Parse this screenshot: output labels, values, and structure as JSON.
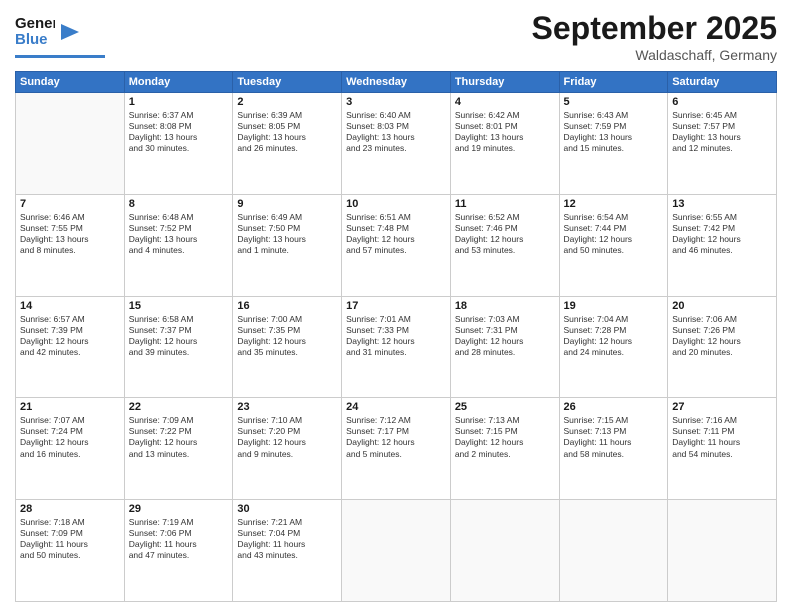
{
  "header": {
    "logo_line1": "General",
    "logo_line2": "Blue",
    "month": "September 2025",
    "location": "Waldaschaff, Germany"
  },
  "days_of_week": [
    "Sunday",
    "Monday",
    "Tuesday",
    "Wednesday",
    "Thursday",
    "Friday",
    "Saturday"
  ],
  "weeks": [
    [
      {
        "day": "",
        "info": ""
      },
      {
        "day": "1",
        "info": "Sunrise: 6:37 AM\nSunset: 8:08 PM\nDaylight: 13 hours\nand 30 minutes."
      },
      {
        "day": "2",
        "info": "Sunrise: 6:39 AM\nSunset: 8:05 PM\nDaylight: 13 hours\nand 26 minutes."
      },
      {
        "day": "3",
        "info": "Sunrise: 6:40 AM\nSunset: 8:03 PM\nDaylight: 13 hours\nand 23 minutes."
      },
      {
        "day": "4",
        "info": "Sunrise: 6:42 AM\nSunset: 8:01 PM\nDaylight: 13 hours\nand 19 minutes."
      },
      {
        "day": "5",
        "info": "Sunrise: 6:43 AM\nSunset: 7:59 PM\nDaylight: 13 hours\nand 15 minutes."
      },
      {
        "day": "6",
        "info": "Sunrise: 6:45 AM\nSunset: 7:57 PM\nDaylight: 13 hours\nand 12 minutes."
      }
    ],
    [
      {
        "day": "7",
        "info": "Sunrise: 6:46 AM\nSunset: 7:55 PM\nDaylight: 13 hours\nand 8 minutes."
      },
      {
        "day": "8",
        "info": "Sunrise: 6:48 AM\nSunset: 7:52 PM\nDaylight: 13 hours\nand 4 minutes."
      },
      {
        "day": "9",
        "info": "Sunrise: 6:49 AM\nSunset: 7:50 PM\nDaylight: 13 hours\nand 1 minute."
      },
      {
        "day": "10",
        "info": "Sunrise: 6:51 AM\nSunset: 7:48 PM\nDaylight: 12 hours\nand 57 minutes."
      },
      {
        "day": "11",
        "info": "Sunrise: 6:52 AM\nSunset: 7:46 PM\nDaylight: 12 hours\nand 53 minutes."
      },
      {
        "day": "12",
        "info": "Sunrise: 6:54 AM\nSunset: 7:44 PM\nDaylight: 12 hours\nand 50 minutes."
      },
      {
        "day": "13",
        "info": "Sunrise: 6:55 AM\nSunset: 7:42 PM\nDaylight: 12 hours\nand 46 minutes."
      }
    ],
    [
      {
        "day": "14",
        "info": "Sunrise: 6:57 AM\nSunset: 7:39 PM\nDaylight: 12 hours\nand 42 minutes."
      },
      {
        "day": "15",
        "info": "Sunrise: 6:58 AM\nSunset: 7:37 PM\nDaylight: 12 hours\nand 39 minutes."
      },
      {
        "day": "16",
        "info": "Sunrise: 7:00 AM\nSunset: 7:35 PM\nDaylight: 12 hours\nand 35 minutes."
      },
      {
        "day": "17",
        "info": "Sunrise: 7:01 AM\nSunset: 7:33 PM\nDaylight: 12 hours\nand 31 minutes."
      },
      {
        "day": "18",
        "info": "Sunrise: 7:03 AM\nSunset: 7:31 PM\nDaylight: 12 hours\nand 28 minutes."
      },
      {
        "day": "19",
        "info": "Sunrise: 7:04 AM\nSunset: 7:28 PM\nDaylight: 12 hours\nand 24 minutes."
      },
      {
        "day": "20",
        "info": "Sunrise: 7:06 AM\nSunset: 7:26 PM\nDaylight: 12 hours\nand 20 minutes."
      }
    ],
    [
      {
        "day": "21",
        "info": "Sunrise: 7:07 AM\nSunset: 7:24 PM\nDaylight: 12 hours\nand 16 minutes."
      },
      {
        "day": "22",
        "info": "Sunrise: 7:09 AM\nSunset: 7:22 PM\nDaylight: 12 hours\nand 13 minutes."
      },
      {
        "day": "23",
        "info": "Sunrise: 7:10 AM\nSunset: 7:20 PM\nDaylight: 12 hours\nand 9 minutes."
      },
      {
        "day": "24",
        "info": "Sunrise: 7:12 AM\nSunset: 7:17 PM\nDaylight: 12 hours\nand 5 minutes."
      },
      {
        "day": "25",
        "info": "Sunrise: 7:13 AM\nSunset: 7:15 PM\nDaylight: 12 hours\nand 2 minutes."
      },
      {
        "day": "26",
        "info": "Sunrise: 7:15 AM\nSunset: 7:13 PM\nDaylight: 11 hours\nand 58 minutes."
      },
      {
        "day": "27",
        "info": "Sunrise: 7:16 AM\nSunset: 7:11 PM\nDaylight: 11 hours\nand 54 minutes."
      }
    ],
    [
      {
        "day": "28",
        "info": "Sunrise: 7:18 AM\nSunset: 7:09 PM\nDaylight: 11 hours\nand 50 minutes."
      },
      {
        "day": "29",
        "info": "Sunrise: 7:19 AM\nSunset: 7:06 PM\nDaylight: 11 hours\nand 47 minutes."
      },
      {
        "day": "30",
        "info": "Sunrise: 7:21 AM\nSunset: 7:04 PM\nDaylight: 11 hours\nand 43 minutes."
      },
      {
        "day": "",
        "info": ""
      },
      {
        "day": "",
        "info": ""
      },
      {
        "day": "",
        "info": ""
      },
      {
        "day": "",
        "info": ""
      }
    ]
  ]
}
